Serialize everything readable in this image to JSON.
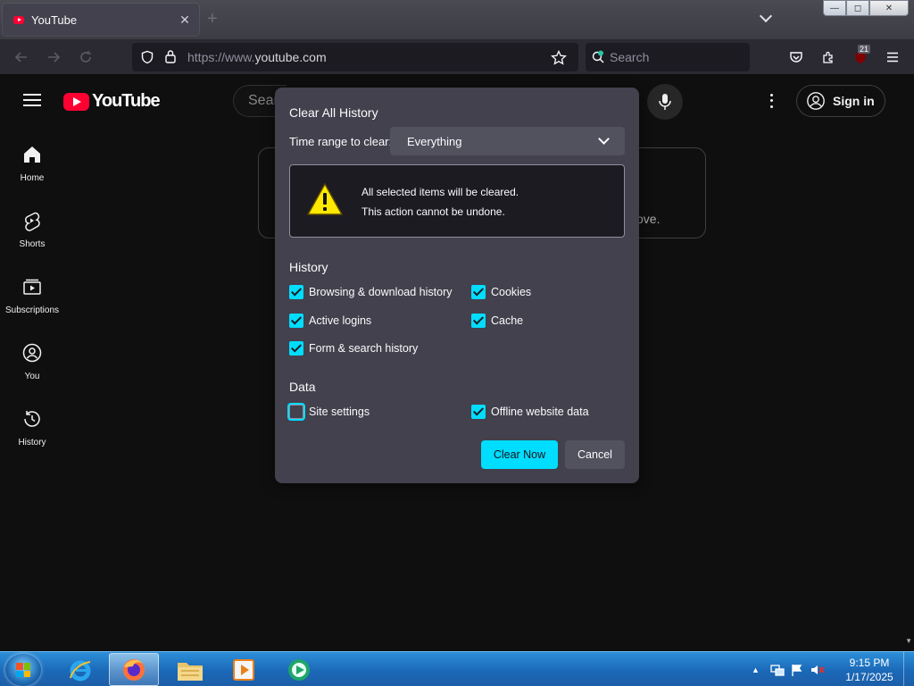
{
  "browser": {
    "tab_title": "YouTube",
    "tab_close": "✕",
    "new_tab": "+",
    "url_prefix": "https://www.",
    "url_domain": "youtube.com",
    "search_placeholder": "Search",
    "extensions_badge": "21",
    "window_controls": {
      "minimize": "—",
      "maximize": "◻",
      "close": "✕"
    }
  },
  "youtube": {
    "logo_text": "YouTube",
    "search_placeholder_fragment": "Sear",
    "sign_in": "Sign in",
    "card_fragment": "ove.",
    "sidebar": [
      {
        "label": "Home",
        "icon": "home-icon"
      },
      {
        "label": "Shorts",
        "icon": "shorts-icon"
      },
      {
        "label": "Subscriptions",
        "icon": "subscriptions-icon"
      },
      {
        "label": "You",
        "icon": "you-icon"
      },
      {
        "label": "History",
        "icon": "history-icon"
      }
    ]
  },
  "dialog": {
    "title": "Clear All History",
    "range_label": "Time range to clear:",
    "range_value": "Everything",
    "warning_line1": "All selected items will be cleared.",
    "warning_line2": "This action cannot be undone.",
    "history_heading": "History",
    "history_items": [
      {
        "label": "Browsing & download history",
        "checked": true
      },
      {
        "label": "Cookies",
        "checked": true
      },
      {
        "label": "Active logins",
        "checked": true
      },
      {
        "label": "Cache",
        "checked": true
      },
      {
        "label": "Form & search history",
        "checked": true
      }
    ],
    "data_heading": "Data",
    "data_items": [
      {
        "label": "Site settings",
        "checked": false
      },
      {
        "label": "Offline website data",
        "checked": true
      }
    ],
    "clear_button": "Clear Now",
    "cancel_button": "Cancel"
  },
  "taskbar": {
    "time": "9:15 PM",
    "date": "1/17/2025"
  },
  "colors": {
    "accent": "#00ddff",
    "dialog_bg": "#42414d",
    "youtube_red": "#ff0033",
    "page_bg": "#0f0f0f"
  }
}
